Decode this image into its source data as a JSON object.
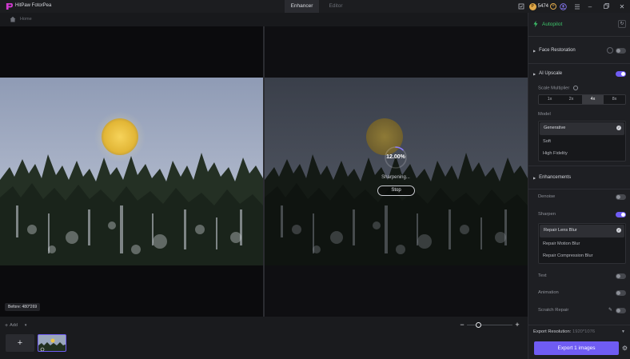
{
  "app": {
    "title": "HitPaw FotorPea"
  },
  "tabs": [
    {
      "label": "Enhancer",
      "active": true
    },
    {
      "label": "Editor",
      "active": false
    }
  ],
  "header": {
    "credits": "5474"
  },
  "breadcrumb": {
    "label": "Home"
  },
  "canvas": {
    "before_label": "Before: 480*269",
    "progress": "12.00%",
    "progress_fraction": 0.12,
    "status": "Sharpening...",
    "stop_label": "Stop"
  },
  "bottom": {
    "add_label": "Add",
    "add_tile": "+"
  },
  "panel": {
    "autopilot": "Autopilot",
    "face_restoration": {
      "label": "Face Restoration",
      "on": false
    },
    "ai_upscale": {
      "label": "AI Upscale",
      "on": true
    },
    "scale_multiplier": {
      "label": "Scale Multiplier",
      "options": [
        "1x",
        "2x",
        "4x",
        "8x"
      ],
      "selected": "4x"
    },
    "model": {
      "label": "Model",
      "options": [
        "Generative",
        "Soft",
        "High Fidelity"
      ],
      "selected": "Generative"
    },
    "enhancements": "Enhancements",
    "denoise": {
      "label": "Denoise",
      "on": false
    },
    "sharpen": {
      "label": "Sharpen",
      "on": true
    },
    "sharpen_options": [
      "Repair Lens Blur",
      "Repair Motion Blur",
      "Repair Compression Blur"
    ],
    "sharpen_selected": "Repair Lens Blur",
    "text": {
      "label": "Text",
      "on": false
    },
    "animation": {
      "label": "Animation",
      "on": false
    },
    "scratch_repair": {
      "label": "Scratch Repair",
      "on": false
    },
    "export_resolution": {
      "label": "Export Resolution:",
      "value": "1920*1076"
    },
    "export_button": "Export 1 images"
  },
  "colors": {
    "accent": "#6f5cf3",
    "autopilot": "#3ec46b",
    "coin": "#e0a94a"
  }
}
